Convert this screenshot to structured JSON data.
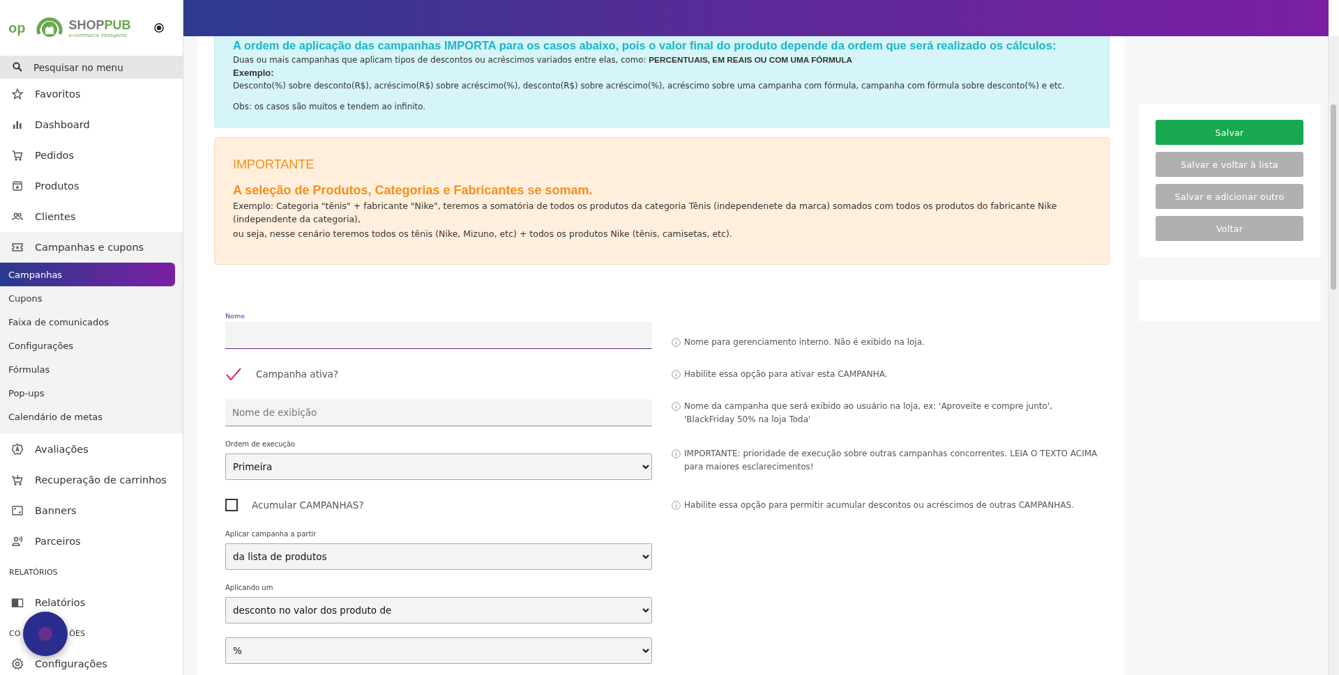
{
  "sidebar": {
    "logo": {
      "mark": "op",
      "brand_dark": "SHOP",
      "brand_accent": "PUB",
      "tagline": "e-commerce inteligente"
    },
    "search": {
      "placeholder": "Pesquisar no menu"
    },
    "items": [
      {
        "kind": "item",
        "label": "Favoritos"
      },
      {
        "kind": "item",
        "label": "Dashboard"
      },
      {
        "kind": "item",
        "label": "Pedidos"
      },
      {
        "kind": "item",
        "label": "Produtos"
      },
      {
        "kind": "item",
        "label": "Clientes"
      },
      {
        "kind": "group",
        "label": "Campanhas e cupons",
        "expanded": true,
        "children": [
          {
            "label": "Campanhas",
            "selected": true
          },
          {
            "label": "Cupons",
            "selected": false
          },
          {
            "label": "Faixa de comunicados",
            "selected": false
          },
          {
            "label": "Configurações",
            "selected": false
          },
          {
            "label": "Fórmulas",
            "selected": false
          },
          {
            "label": "Pop-ups",
            "selected": false
          },
          {
            "label": "Calendário de metas",
            "selected": false
          }
        ]
      },
      {
        "kind": "item",
        "label": "Avaliações"
      },
      {
        "kind": "item",
        "label": "Recuperação de carrinhos"
      },
      {
        "kind": "item",
        "label": "Banners"
      },
      {
        "kind": "item",
        "label": "Parceiros"
      },
      {
        "kind": "heading",
        "label": "RELATÓRIOS"
      },
      {
        "kind": "item",
        "label": "Relatórios"
      },
      {
        "kind": "heading",
        "label": "CO",
        "label_after": "ÕES"
      },
      {
        "kind": "item",
        "label": "Configurações"
      }
    ]
  },
  "info": {
    "title": "A ordem de aplicação das campanhas IMPORTA para os casos abaixo, pois o valor final do produto depende da ordem que será realizado os cálculos:",
    "lines": [
      {
        "kind": "text",
        "text": "Duas ou mais campanhas que aplicam tipos de descontos ou acréscimos variados entre elas, como: **PERCENTUAIS, EM REAIS OU COM UMA FÓRMULA**"
      },
      {
        "kind": "label",
        "text": "Exemplo:"
      },
      {
        "kind": "text",
        "text": "Desconto(%) sobre desconto(R$), acréscimo(R$) sobre acréscimo(%), desconto(R$) sobre acréscimo(%), acréscimo sobre uma campanha com fórmula, campanha com fórmula sobre desconto(%) e etc."
      },
      {
        "kind": "note",
        "text": "Obs: os casos são muitos e tendem ao infinito."
      }
    ]
  },
  "warning": {
    "heading": "IMPORTANTE",
    "subtitle": "A seleção de Produtos, Categorias e Fabricantes se somam.",
    "paragraphs": [
      "Exemplo: Categoria \"tênis\" + fabricante \"Nike\", teremos a somatória de todos os produtos da categoria Tênis (independenete da marca) somados com todos os produtos do fabricante Nike (independente da categoria),",
      "ou seja, nesse cenário teremos todos os tênis (Nike, Mizuno, etc) + todos os produtos Nike (tênis, camisetas, etc)."
    ]
  },
  "form": [
    {
      "kind": "text",
      "label": "Nome",
      "focused": true,
      "hint": "Nome para gerenciamento interno. Não é exibido na loja."
    },
    {
      "kind": "checkbox",
      "label": "Campanha ativa?",
      "checked": true,
      "hint": "Habilite essa opção para ativar esta CAMPANHA."
    },
    {
      "kind": "text",
      "placeholder": "Nome de exibição",
      "focused": false,
      "hint": "Nome da campanha que será exibido ao usuário na loja, ex: 'Aproveite e compre junto', 'BlackFriday 50% na loja Toda'"
    },
    {
      "kind": "select",
      "label": "Ordem de execução",
      "value": "Primeira",
      "hint": "IMPORTANTE: prioridade de execução sobre outras campanhas concorrentes. LEIA O TEXTO ACIMA para maiores esclarecimentos!"
    },
    {
      "kind": "checkbox",
      "label": "Acumular CAMPANHAS?",
      "checked": false,
      "hint": "Habilite essa opção para permitir acumular descontos ou acréscimos de outras CAMPANHAS."
    },
    {
      "kind": "select",
      "label": "Aplicar campanha a partir",
      "value": "da lista de produtos"
    },
    {
      "kind": "select",
      "label": "Aplicando um",
      "value": "desconto no valor dos produto de"
    },
    {
      "kind": "select",
      "value": "%"
    }
  ],
  "actions": [
    {
      "label": "Salvar",
      "kind": "primary"
    },
    {
      "label": "Salvar e voltar à lista",
      "kind": "secondary"
    },
    {
      "label": "Salvar e adicionar outro",
      "kind": "secondary"
    },
    {
      "label": "Voltar",
      "kind": "secondary"
    }
  ]
}
